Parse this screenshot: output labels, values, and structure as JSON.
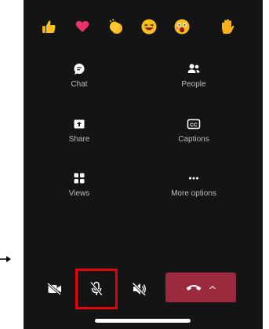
{
  "reactions": [
    {
      "name": "like-reaction",
      "icon": "thumbs-up"
    },
    {
      "name": "heart-reaction",
      "icon": "heart"
    },
    {
      "name": "applause-reaction",
      "icon": "clapping-hands"
    },
    {
      "name": "laugh-reaction",
      "icon": "laughing-face"
    },
    {
      "name": "surprised-reaction",
      "icon": "surprised-face"
    },
    {
      "name": "raise-hand-reaction",
      "icon": "raised-hand"
    }
  ],
  "options": {
    "chat": {
      "label": "Chat",
      "icon": "chat-icon"
    },
    "people": {
      "label": "People",
      "icon": "people-icon"
    },
    "share": {
      "label": "Share",
      "icon": "share-icon"
    },
    "captions": {
      "label": "Captions",
      "icon": "captions-icon"
    },
    "views": {
      "label": "Views",
      "icon": "views-icon"
    },
    "more_options": {
      "label": "More options",
      "icon": "more-icon"
    }
  },
  "callbar": {
    "camera": {
      "icon": "camera-off-icon"
    },
    "mic": {
      "icon": "mic-off-icon",
      "highlighted": true
    },
    "speaker": {
      "icon": "speaker-icon"
    },
    "hangup": {
      "icon": "hang-up-icon",
      "chevron": "chevron-up-icon"
    }
  },
  "colors": {
    "background": "#141414",
    "label": "#bdbdbd",
    "hangup": "#9a2b3e",
    "highlight": "#e4000f"
  }
}
